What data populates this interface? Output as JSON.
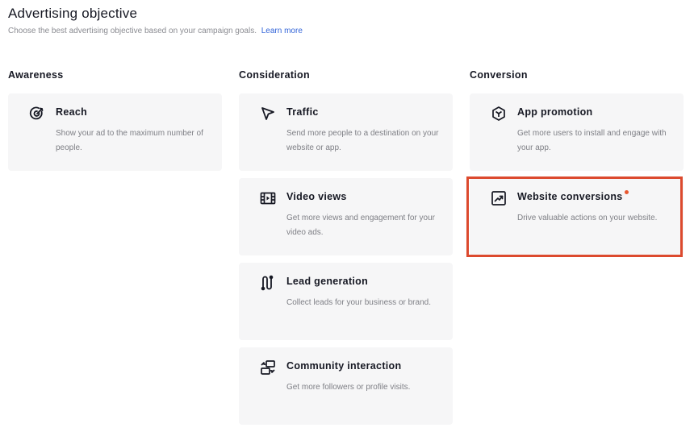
{
  "header": {
    "title": "Advertising objective",
    "subtitle": "Choose the best advertising objective based on your campaign goals.",
    "learn_more": "Learn more"
  },
  "columns": {
    "awareness": "Awareness",
    "consideration": "Consideration",
    "conversion": "Conversion"
  },
  "objectives": {
    "reach": {
      "title": "Reach",
      "desc": "Show your ad to the maximum number of people.",
      "icon": "target-icon"
    },
    "traffic": {
      "title": "Traffic",
      "desc": "Send more people to a destination on your website or app.",
      "icon": "cursor-icon"
    },
    "video_views": {
      "title": "Video views",
      "desc": "Get more views and engagement for your video ads.",
      "icon": "film-icon"
    },
    "lead_generation": {
      "title": "Lead generation",
      "desc": "Collect leads for your business or brand.",
      "icon": "route-icon"
    },
    "community_interaction": {
      "title": "Community interaction",
      "desc": "Get more followers or profile visits.",
      "icon": "community-icon"
    },
    "app_promotion": {
      "title": "App promotion",
      "desc": "Get more users to install and engage with your app.",
      "icon": "cube-icon"
    },
    "website_conversions": {
      "title": "Website conversions",
      "desc": "Drive valuable actions on your website.",
      "icon": "trend-up-icon"
    }
  },
  "colors": {
    "highlight_border": "#dc4a2e",
    "new_dot": "#e8572f",
    "link": "#3264d8",
    "card_bg": "#f6f6f7"
  }
}
